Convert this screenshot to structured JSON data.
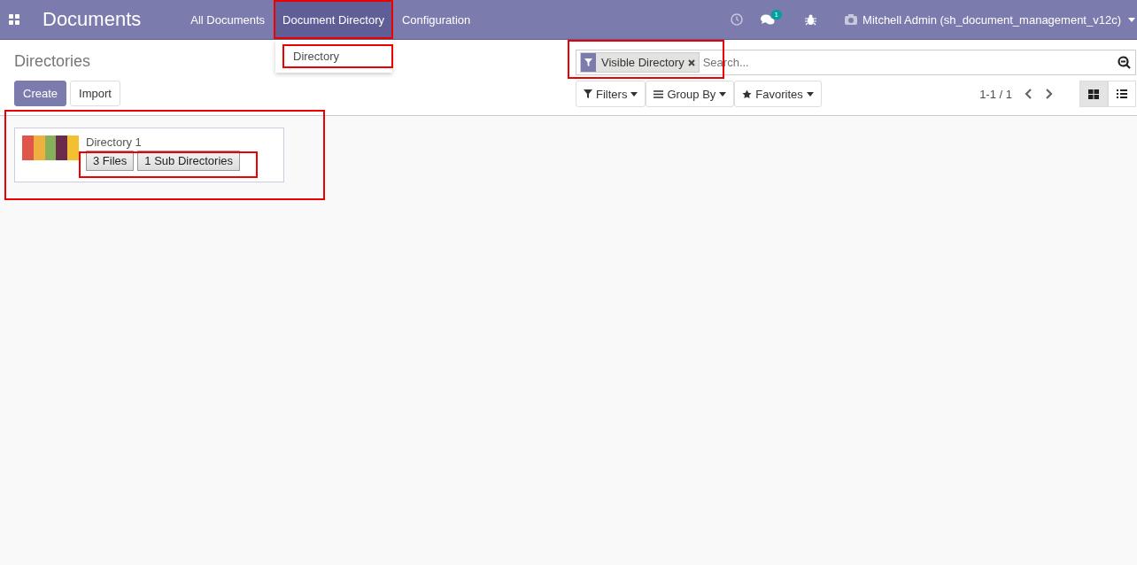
{
  "navbar": {
    "app_title": "Documents",
    "menus": [
      {
        "label": "All Documents",
        "selected": false,
        "highlighted": false
      },
      {
        "label": "Document Directory",
        "selected": true,
        "highlighted": true
      },
      {
        "label": "Configuration",
        "selected": false,
        "highlighted": false
      }
    ],
    "message_count": "1",
    "user": "Mitchell Admin (sh_document_management_v12c)"
  },
  "dropdown": {
    "items": [
      {
        "label": "Directory",
        "highlighted": true
      }
    ]
  },
  "control_panel": {
    "breadcrumb": "Directories",
    "buttons": [
      {
        "label": "Create",
        "kind": "primary"
      },
      {
        "label": "Import",
        "kind": "secondary"
      }
    ],
    "search": {
      "facet": "Visible Directory",
      "placeholder": "Search..."
    },
    "filters": [
      {
        "label": "Filters",
        "kind": "filter"
      },
      {
        "label": "Group By",
        "kind": "group"
      },
      {
        "label": "Favorites",
        "kind": "star"
      }
    ],
    "pager": "1-1 / 1",
    "views": [
      {
        "kind": "kanban",
        "selected": true
      },
      {
        "kind": "list",
        "selected": false
      }
    ]
  },
  "cards": [
    {
      "name": "Directory 1",
      "buttons": [
        "3 Files",
        "1 Sub Directories"
      ]
    }
  ]
}
